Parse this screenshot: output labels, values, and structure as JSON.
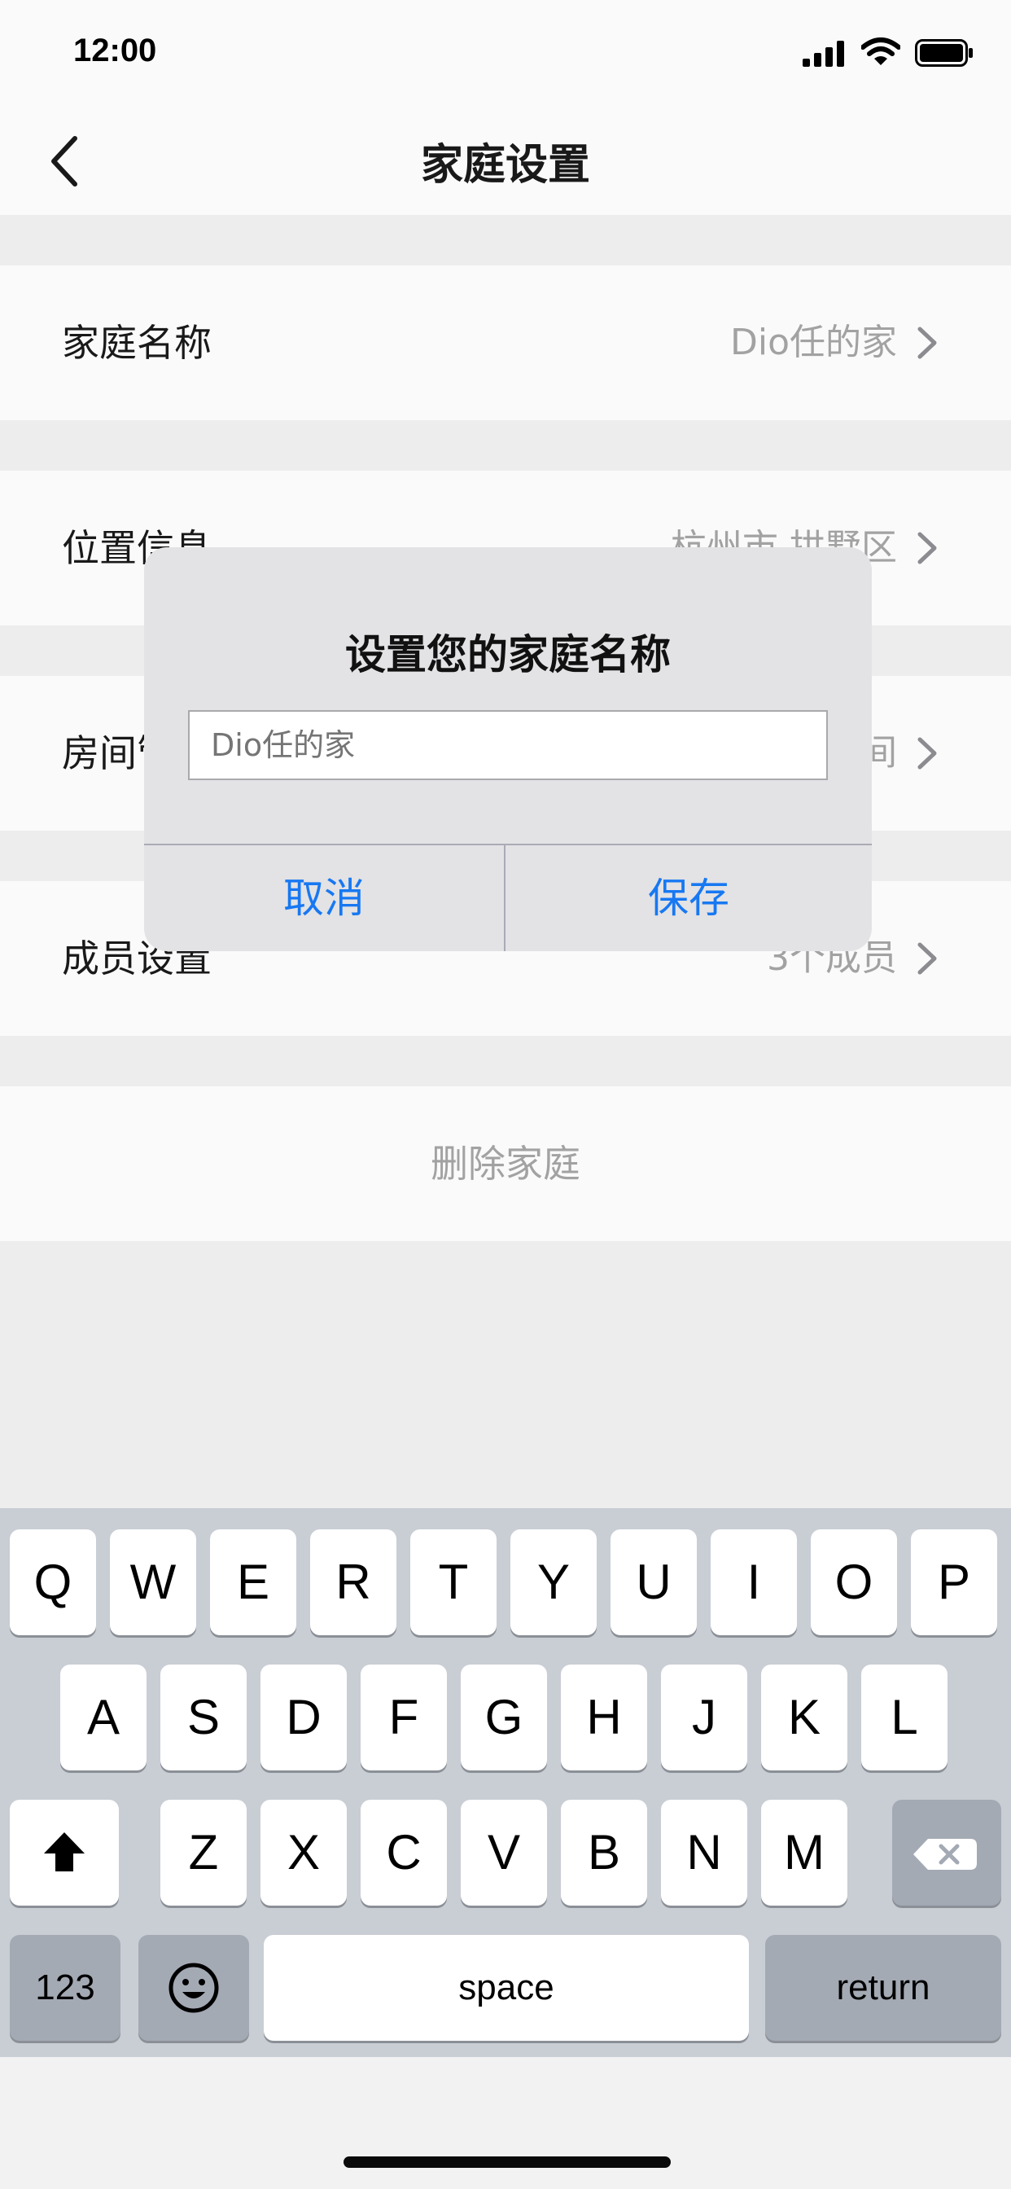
{
  "status_bar": {
    "time": "12:00"
  },
  "nav": {
    "title": "家庭设置",
    "back_icon": "chevron-left-icon"
  },
  "settings": {
    "items": [
      {
        "label": "家庭名称",
        "value": "Dio任的家"
      },
      {
        "label": "位置信息",
        "value": "杭州市 拱墅区"
      },
      {
        "label": "房间管理",
        "value": "个房间"
      },
      {
        "label": "成员设置",
        "value": "3个成员"
      }
    ],
    "delete_label": "删除家庭"
  },
  "dialog": {
    "title": "设置您的家庭名称",
    "input_placeholder": "Dio任的家",
    "cancel_label": "取消",
    "save_label": "保存"
  },
  "keyboard": {
    "row1": [
      "Q",
      "W",
      "E",
      "R",
      "T",
      "Y",
      "U",
      "I",
      "O",
      "P"
    ],
    "row2": [
      "A",
      "S",
      "D",
      "F",
      "G",
      "H",
      "J",
      "K",
      "L"
    ],
    "row3": [
      "Z",
      "X",
      "C",
      "V",
      "B",
      "N",
      "M"
    ],
    "numbers_label": "123",
    "space_label": "space",
    "return_label": "return"
  },
  "colors": {
    "accent": "#1778f2",
    "secondary_text": "#a6a6a6",
    "background": "#f2f2f3"
  }
}
